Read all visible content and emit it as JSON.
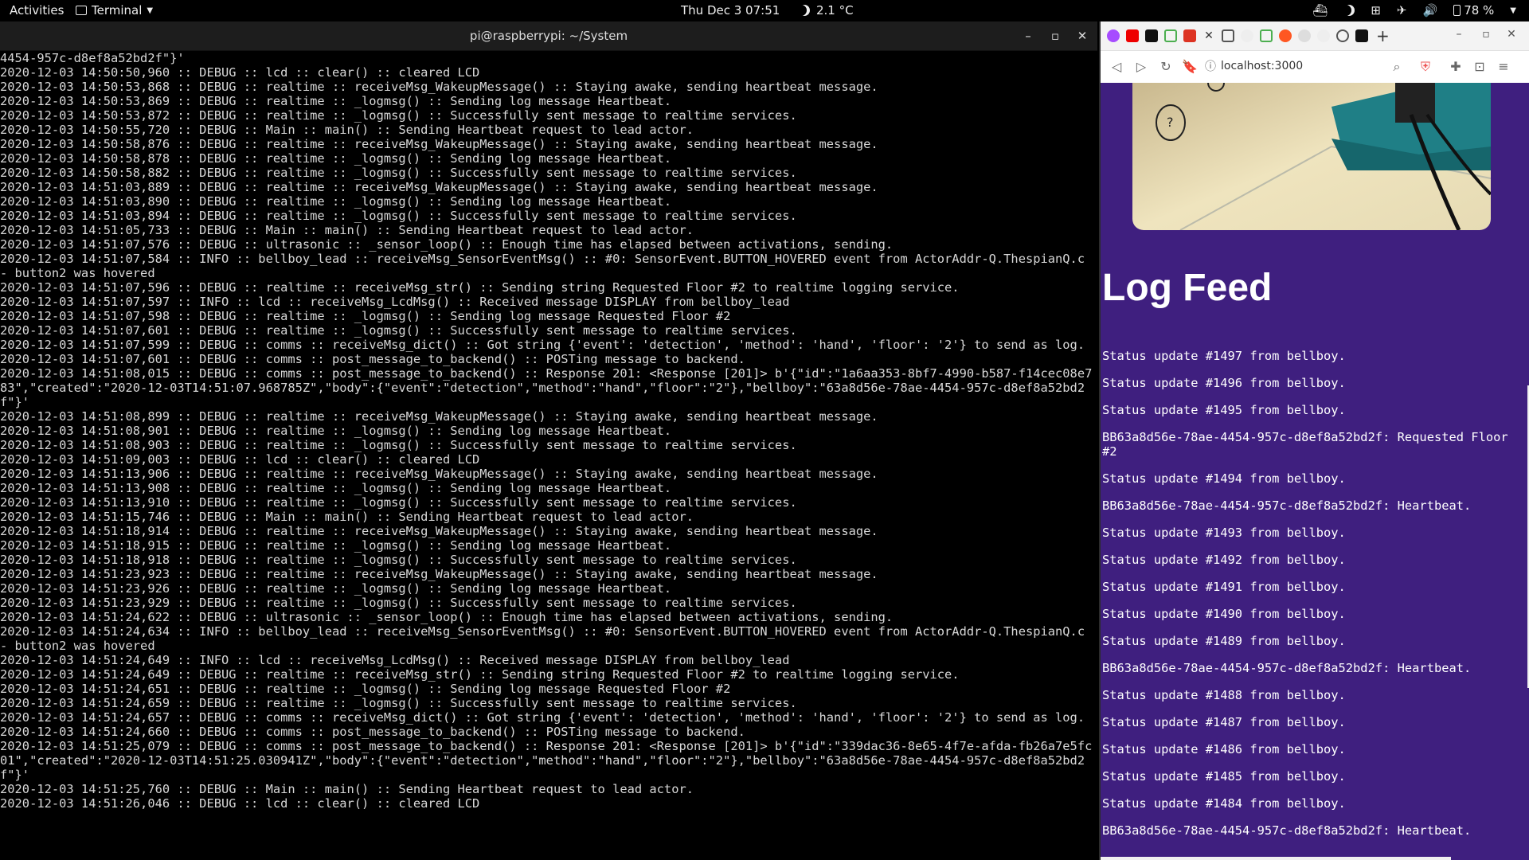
{
  "topbar": {
    "activities": "Activities",
    "app_menu": "Terminal",
    "clock": "Thu Dec 3  07:51",
    "temperature": "2.1 °C",
    "battery": "78 %"
  },
  "terminal": {
    "title": "pi@raspberrypi: ~/System",
    "lines": [
      "4454-957c-d8ef8a52bd2f\"}'",
      "2020-12-03 14:50:50,960 :: DEBUG :: lcd :: clear() :: cleared LCD",
      "2020-12-03 14:50:53,868 :: DEBUG :: realtime :: receiveMsg_WakeupMessage() :: Staying awake, sending heartbeat message.",
      "2020-12-03 14:50:53,869 :: DEBUG :: realtime :: _logmsg() :: Sending log message Heartbeat.",
      "2020-12-03 14:50:53,872 :: DEBUG :: realtime :: _logmsg() :: Successfully sent message to realtime services.",
      "2020-12-03 14:50:55,720 :: DEBUG :: Main :: main() :: Sending Heartbeat request to lead actor.",
      "2020-12-03 14:50:58,876 :: DEBUG :: realtime :: receiveMsg_WakeupMessage() :: Staying awake, sending heartbeat message.",
      "2020-12-03 14:50:58,878 :: DEBUG :: realtime :: _logmsg() :: Sending log message Heartbeat.",
      "2020-12-03 14:50:58,882 :: DEBUG :: realtime :: _logmsg() :: Successfully sent message to realtime services.",
      "2020-12-03 14:51:03,889 :: DEBUG :: realtime :: receiveMsg_WakeupMessage() :: Staying awake, sending heartbeat message.",
      "2020-12-03 14:51:03,890 :: DEBUG :: realtime :: _logmsg() :: Sending log message Heartbeat.",
      "2020-12-03 14:51:03,894 :: DEBUG :: realtime :: _logmsg() :: Successfully sent message to realtime services.",
      "2020-12-03 14:51:05,733 :: DEBUG :: Main :: main() :: Sending Heartbeat request to lead actor.",
      "2020-12-03 14:51:07,576 :: DEBUG :: ultrasonic :: _sensor_loop() :: Enough time has elapsed between activations, sending.",
      "2020-12-03 14:51:07,584 :: INFO :: bellboy_lead :: receiveMsg_SensorEventMsg() :: #0: SensorEvent.BUTTON_HOVERED event from ActorAddr-Q.ThespianQ.c - button2 was hovered",
      "2020-12-03 14:51:07,596 :: DEBUG :: realtime :: receiveMsg_str() :: Sending string Requested Floor #2 to realtime logging service.",
      "2020-12-03 14:51:07,597 :: INFO :: lcd :: receiveMsg_LcdMsg() :: Received message DISPLAY from bellboy_lead",
      "2020-12-03 14:51:07,598 :: DEBUG :: realtime :: _logmsg() :: Sending log message Requested Floor #2",
      "2020-12-03 14:51:07,601 :: DEBUG :: realtime :: _logmsg() :: Successfully sent message to realtime services.",
      "2020-12-03 14:51:07,599 :: DEBUG :: comms :: receiveMsg_dict() :: Got string {'event': 'detection', 'method': 'hand', 'floor': '2'} to send as log.",
      "2020-12-03 14:51:07,601 :: DEBUG :: comms :: post_message_to_backend() :: POSTing message to backend.",
      "2020-12-03 14:51:08,015 :: DEBUG :: comms :: post_message_to_backend() :: Response 201: <Response [201]> b'{\"id\":\"1a6aa353-8bf7-4990-b587-f14cec08e783\",\"created\":\"2020-12-03T14:51:07.968785Z\",\"body\":{\"event\":\"detection\",\"method\":\"hand\",\"floor\":\"2\"},\"bellboy\":\"63a8d56e-78ae-4454-957c-d8ef8a52bd2f\"}'",
      "2020-12-03 14:51:08,899 :: DEBUG :: realtime :: receiveMsg_WakeupMessage() :: Staying awake, sending heartbeat message.",
      "2020-12-03 14:51:08,901 :: DEBUG :: realtime :: _logmsg() :: Sending log message Heartbeat.",
      "2020-12-03 14:51:08,903 :: DEBUG :: realtime :: _logmsg() :: Successfully sent message to realtime services.",
      "2020-12-03 14:51:09,003 :: DEBUG :: lcd :: clear() :: cleared LCD",
      "2020-12-03 14:51:13,906 :: DEBUG :: realtime :: receiveMsg_WakeupMessage() :: Staying awake, sending heartbeat message.",
      "2020-12-03 14:51:13,908 :: DEBUG :: realtime :: _logmsg() :: Sending log message Heartbeat.",
      "2020-12-03 14:51:13,910 :: DEBUG :: realtime :: _logmsg() :: Successfully sent message to realtime services.",
      "2020-12-03 14:51:15,746 :: DEBUG :: Main :: main() :: Sending Heartbeat request to lead actor.",
      "2020-12-03 14:51:18,914 :: DEBUG :: realtime :: receiveMsg_WakeupMessage() :: Staying awake, sending heartbeat message.",
      "2020-12-03 14:51:18,915 :: DEBUG :: realtime :: _logmsg() :: Sending log message Heartbeat.",
      "2020-12-03 14:51:18,918 :: DEBUG :: realtime :: _logmsg() :: Successfully sent message to realtime services.",
      "2020-12-03 14:51:23,923 :: DEBUG :: realtime :: receiveMsg_WakeupMessage() :: Staying awake, sending heartbeat message.",
      "2020-12-03 14:51:23,926 :: DEBUG :: realtime :: _logmsg() :: Sending log message Heartbeat.",
      "2020-12-03 14:51:23,929 :: DEBUG :: realtime :: _logmsg() :: Successfully sent message to realtime services.",
      "2020-12-03 14:51:24,622 :: DEBUG :: ultrasonic :: _sensor_loop() :: Enough time has elapsed between activations, sending.",
      "2020-12-03 14:51:24,634 :: INFO :: bellboy_lead :: receiveMsg_SensorEventMsg() :: #0: SensorEvent.BUTTON_HOVERED event from ActorAddr-Q.ThespianQ.c - button2 was hovered",
      "2020-12-03 14:51:24,649 :: INFO :: lcd :: receiveMsg_LcdMsg() :: Received message DISPLAY from bellboy_lead",
      "2020-12-03 14:51:24,649 :: DEBUG :: realtime :: receiveMsg_str() :: Sending string Requested Floor #2 to realtime logging service.",
      "2020-12-03 14:51:24,651 :: DEBUG :: realtime :: _logmsg() :: Sending log message Requested Floor #2",
      "2020-12-03 14:51:24,659 :: DEBUG :: realtime :: _logmsg() :: Successfully sent message to realtime services.",
      "2020-12-03 14:51:24,657 :: DEBUG :: comms :: receiveMsg_dict() :: Got string {'event': 'detection', 'method': 'hand', 'floor': '2'} to send as log.",
      "2020-12-03 14:51:24,660 :: DEBUG :: comms :: post_message_to_backend() :: POSTing message to backend.",
      "2020-12-03 14:51:25,079 :: DEBUG :: comms :: post_message_to_backend() :: Response 201: <Response [201]> b'{\"id\":\"339dac36-8e65-4f7e-afda-fb26a7e5fc01\",\"created\":\"2020-12-03T14:51:25.030941Z\",\"body\":{\"event\":\"detection\",\"method\":\"hand\",\"floor\":\"2\"},\"bellboy\":\"63a8d56e-78ae-4454-957c-d8ef8a52bd2f\"}'",
      "2020-12-03 14:51:25,760 :: DEBUG :: Main :: main() :: Sending Heartbeat request to lead actor.",
      "2020-12-03 14:51:26,046 :: DEBUG :: lcd :: clear() :: cleared LCD"
    ]
  },
  "browser": {
    "url": "localhost:3000",
    "page_title": "Log Feed",
    "feed": [
      "Status update #1497 from bellboy.",
      "Status update #1496 from bellboy.",
      "Status update #1495 from bellboy.",
      "BB63a8d56e-78ae-4454-957c-d8ef8a52bd2f: Requested Floor #2",
      "Status update #1494 from bellboy.",
      "BB63a8d56e-78ae-4454-957c-d8ef8a52bd2f: Heartbeat.",
      "Status update #1493 from bellboy.",
      "Status update #1492 from bellboy.",
      "Status update #1491 from bellboy.",
      "Status update #1490 from bellboy.",
      "Status update #1489 from bellboy.",
      "BB63a8d56e-78ae-4454-957c-d8ef8a52bd2f: Heartbeat.",
      "Status update #1488 from bellboy.",
      "Status update #1487 from bellboy.",
      "Status update #1486 from bellboy.",
      "Status update #1485 from bellboy.",
      "Status update #1484 from bellboy.",
      "BB63a8d56e-78ae-4454-957c-d8ef8a52bd2f: Heartbeat."
    ],
    "camera_label": "?"
  },
  "colors": {
    "page_bg": "#3f1f7f",
    "terminal_text": "#d8d8d8"
  }
}
